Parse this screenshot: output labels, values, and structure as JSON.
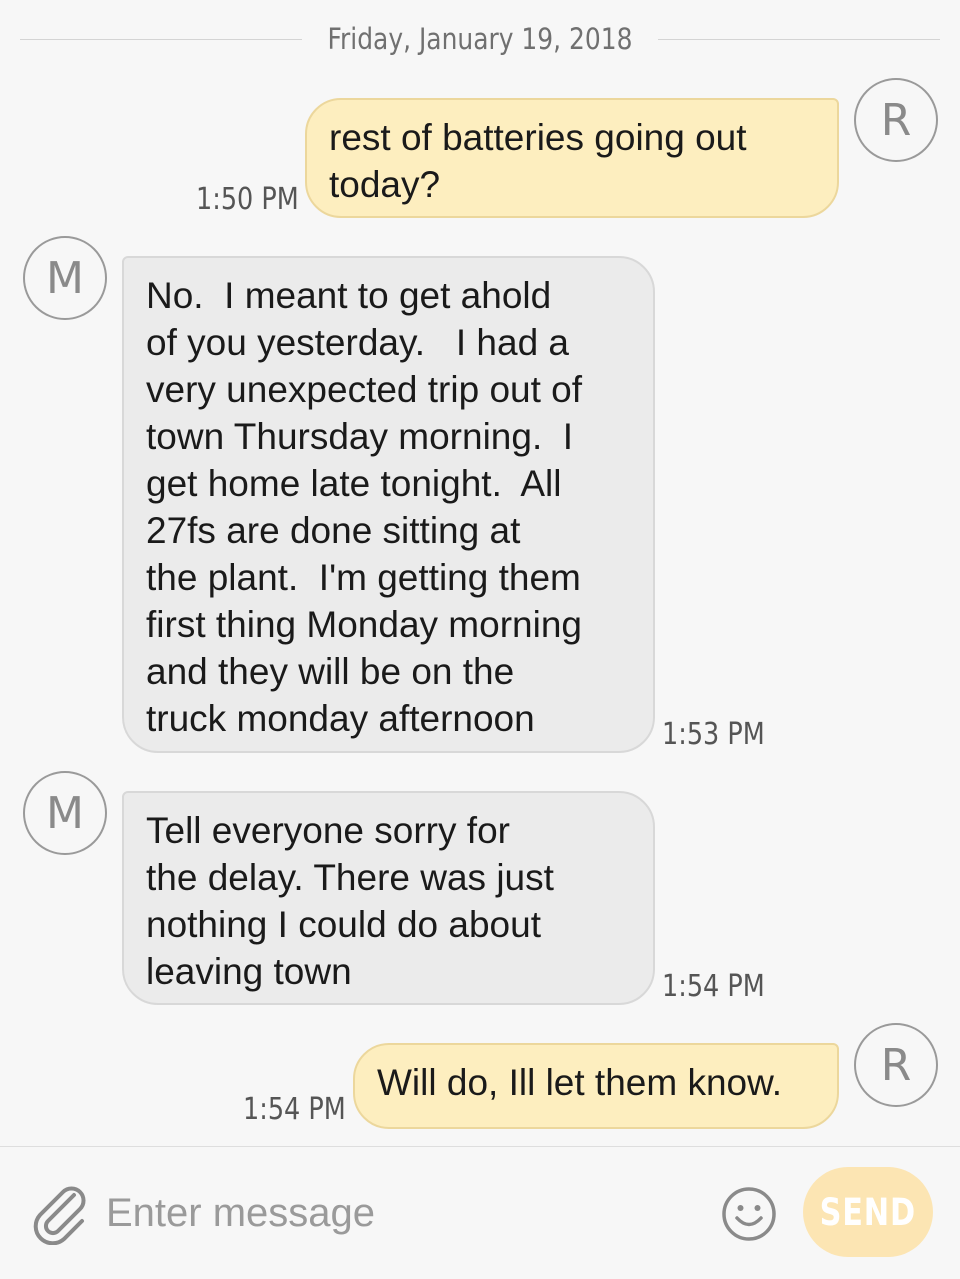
{
  "date_header": "Friday, January 19, 2018",
  "messages": [
    {
      "direction": "outgoing",
      "avatar_letter": "R",
      "text": "rest of batteries going out\ntoday?",
      "time": "1:50 PM"
    },
    {
      "direction": "incoming",
      "avatar_letter": "M",
      "text": "No.  I meant to get ahold\nof you yesterday.   I had a\nvery unexpected trip out of\ntown Thursday morning.  I\nget home late tonight.  All\n27fs are done sitting at\nthe plant.  I'm getting them\nfirst thing Monday morning\nand they will be on the\ntruck monday afternoon",
      "time": "1:53 PM"
    },
    {
      "direction": "incoming",
      "avatar_letter": "M",
      "text": "Tell everyone sorry for\nthe delay. There was just\nnothing I could do about\nleaving town",
      "time": "1:54 PM"
    },
    {
      "direction": "outgoing",
      "avatar_letter": "R",
      "text": "Will do, Ill let them know.",
      "time": "1:54 PM"
    }
  ],
  "composer": {
    "placeholder": "Enter message",
    "value": "",
    "send_label": "SEND",
    "attach_icon": "paperclip-icon",
    "emoji_icon": "smiley-icon"
  },
  "colors": {
    "background": "#f7f7f7",
    "outgoing_bubble": "#fdeebf",
    "incoming_bubble": "#ebebeb",
    "send_button": "#fce5b3"
  }
}
